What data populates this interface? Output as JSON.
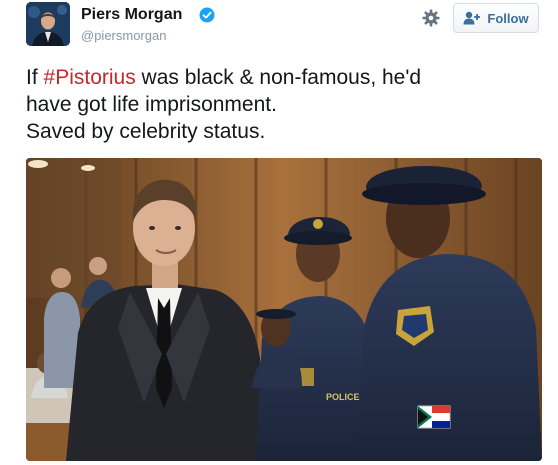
{
  "tweet": {
    "author": {
      "name": "Piers Morgan",
      "handle": "@piersmorgan"
    },
    "follow_label": "Follow",
    "text": {
      "before": "If ",
      "hashtag": "#Pistorius",
      "line1_after": " was black & non-famous, he'd",
      "line2": "have got life imprisonment.",
      "line3": "Saved by celebrity status."
    },
    "media": {
      "badge_text": "POLICE"
    }
  },
  "colors": {
    "hashtag": "#c6272c",
    "name": "#14171a",
    "handle": "#8899a6",
    "follow_text": "#3b6f9c",
    "verified": "#1da1f2"
  },
  "icons": [
    "verified-badge-icon",
    "gear-icon",
    "follow-user-icon"
  ]
}
